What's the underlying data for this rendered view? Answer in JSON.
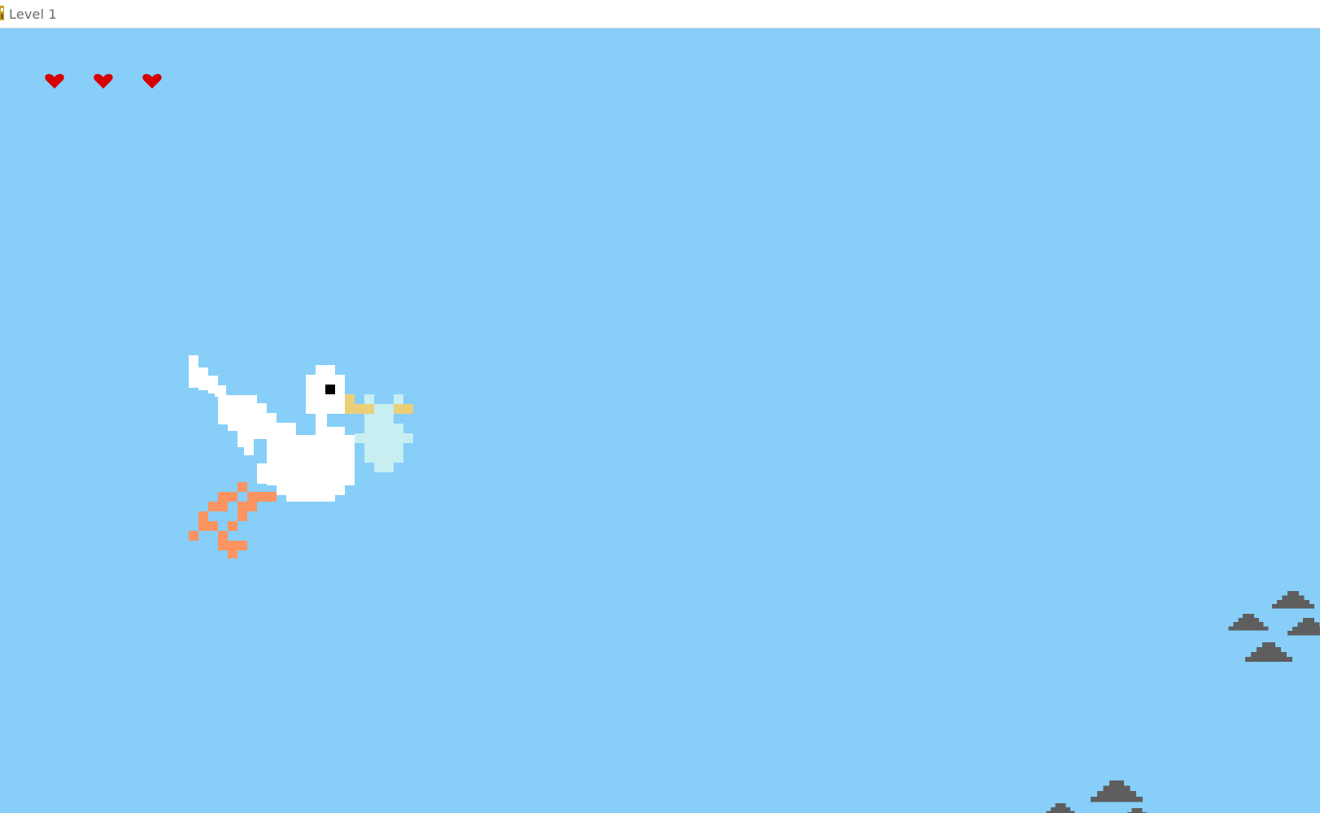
{
  "window": {
    "title": "Level 1",
    "icon": "game-app-icon"
  },
  "game": {
    "sky_color": "#87CEF8",
    "lives": 3,
    "heart_color": "#D60000",
    "player": {
      "sprite": "stork-carrying-baby",
      "colors": {
        "body": "#FFFFFF",
        "eye": "#000000",
        "beak": "#EBCF78",
        "legs": "#FB9461",
        "bundle": "#C7EEF1"
      }
    },
    "obstacles": {
      "sprite": "storm-cloud",
      "color": "#5E5E5E"
    }
  }
}
